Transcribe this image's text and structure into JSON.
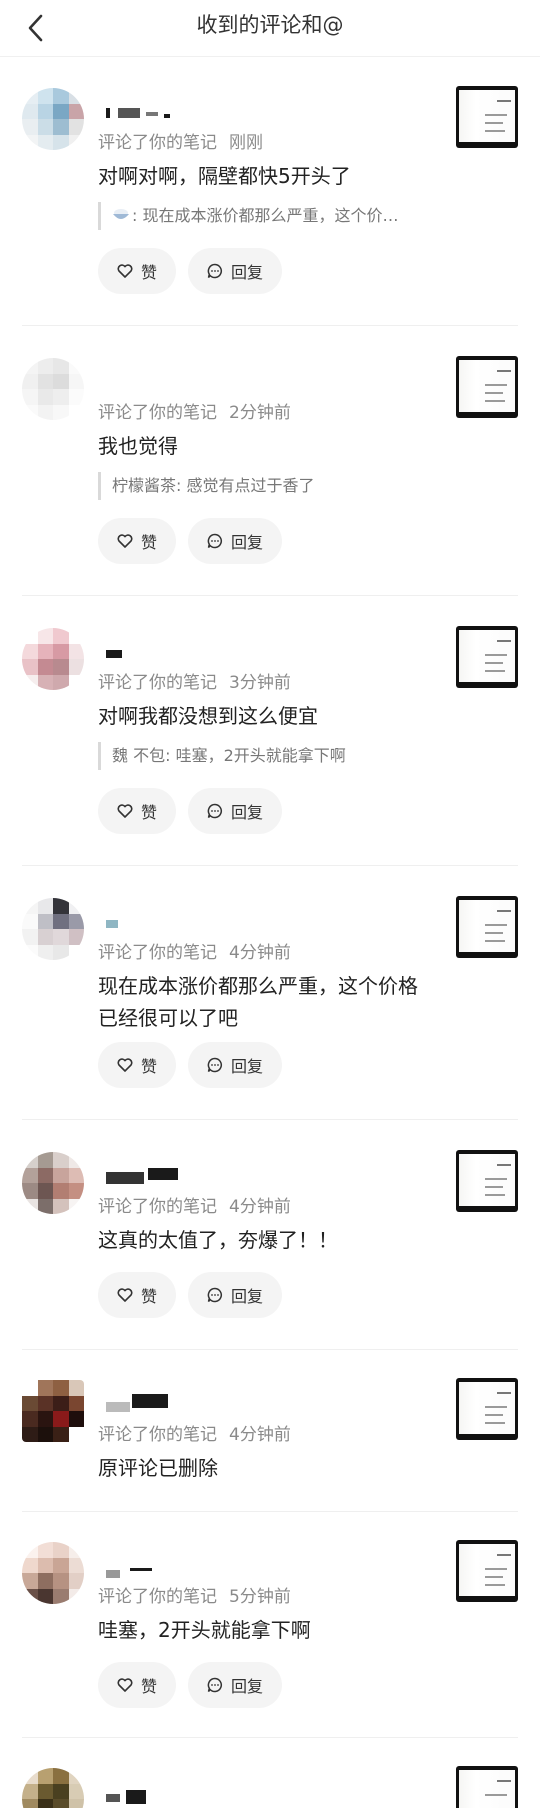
{
  "header": {
    "title": "收到的评论和@"
  },
  "actions": {
    "like_label": "赞",
    "reply_label": "回复"
  },
  "items": [
    {
      "action": "评论了你的笔记",
      "time": "刚刚",
      "comment": "对啊对啊，隔壁都快5开头了",
      "quote": ": 现在成本涨价都那么严重，这个价…",
      "has_actions": true
    },
    {
      "action": "评论了你的笔记",
      "time": "2分钟前",
      "comment": "我也觉得",
      "quote": "柠檬酱茶: 感觉有点过于香了",
      "has_actions": true
    },
    {
      "action": "评论了你的笔记",
      "time": "3分钟前",
      "comment": "对啊我都没想到这么便宜",
      "quote": "魏 不包: 哇塞，2开头就能拿下啊",
      "has_actions": true
    },
    {
      "action": "评论了你的笔记",
      "time": "4分钟前",
      "comment": "现在成本涨价都那么严重，这个价格已经很可以了吧",
      "quote": "",
      "has_actions": true
    },
    {
      "action": "评论了你的笔记",
      "time": "4分钟前",
      "comment": "这真的太值了，夯爆了！！",
      "quote": "",
      "has_actions": true
    },
    {
      "action": "评论了你的笔记",
      "time": "4分钟前",
      "comment": "原评论已删除",
      "quote": "",
      "has_actions": false
    },
    {
      "action": "评论了你的笔记",
      "time": "5分钟前",
      "comment": "哇塞，2开头就能拿下啊",
      "quote": "",
      "has_actions": true
    },
    {
      "action": "",
      "time": "",
      "comment": "",
      "quote": "",
      "has_actions": false
    }
  ],
  "icons": {
    "back": "chevron-left-icon",
    "like": "heart-outline-icon",
    "reply": "chat-bubble-icon"
  }
}
